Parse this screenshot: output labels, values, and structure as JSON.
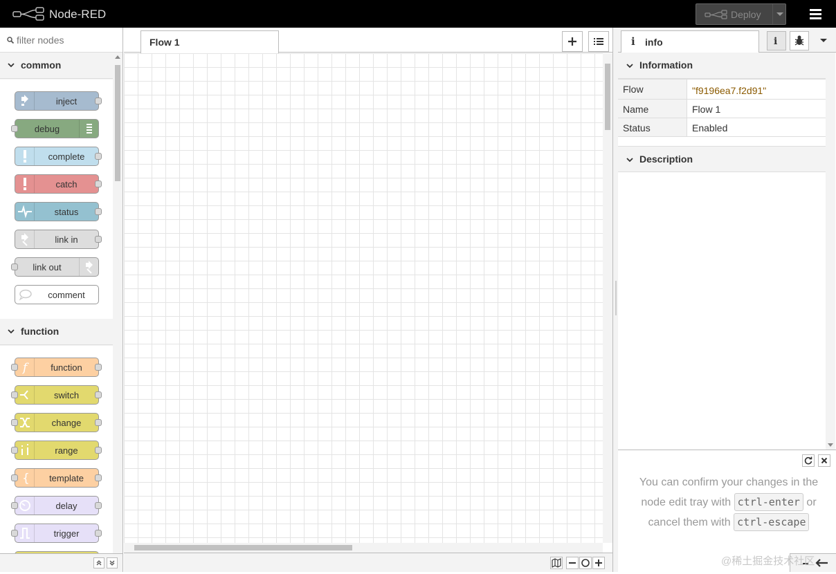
{
  "app": {
    "title": "Node-RED"
  },
  "header": {
    "deploy_label": "Deploy"
  },
  "palette": {
    "filter_placeholder": "filter nodes",
    "categories": [
      {
        "label": "common",
        "nodes": [
          "inject",
          "debug",
          "complete",
          "catch",
          "status",
          "link in",
          "link out",
          "comment"
        ]
      },
      {
        "label": "function",
        "nodes": [
          "function",
          "switch",
          "change",
          "range",
          "template",
          "delay",
          "trigger"
        ]
      }
    ]
  },
  "workspace": {
    "tabs": [
      {
        "label": "Flow 1"
      }
    ]
  },
  "sidebar": {
    "tab_label": "info",
    "info_glyph": "i",
    "sections": {
      "information": "Information",
      "description": "Description"
    },
    "info_rows": [
      {
        "key": "Flow",
        "value": "\"f9196ea7.f2d91\""
      },
      {
        "key": "Name",
        "value": "Flow 1"
      },
      {
        "key": "Status",
        "value": "Enabled"
      }
    ],
    "tips": {
      "part1": "You can confirm your changes in the node edit tray with",
      "kbd1": "ctrl-enter",
      "part2": "or cancel them with",
      "kbd2": "ctrl-escape"
    }
  },
  "watermark": "@稀土掘金技术社区",
  "colors": {
    "header_bg": "#000000",
    "inject": "#a6bbcf",
    "debug": "#87a980",
    "complete": "#c0deed",
    "catch": "#e49191",
    "function_orange": "#fdd0a2",
    "comment": "#ffffff"
  }
}
